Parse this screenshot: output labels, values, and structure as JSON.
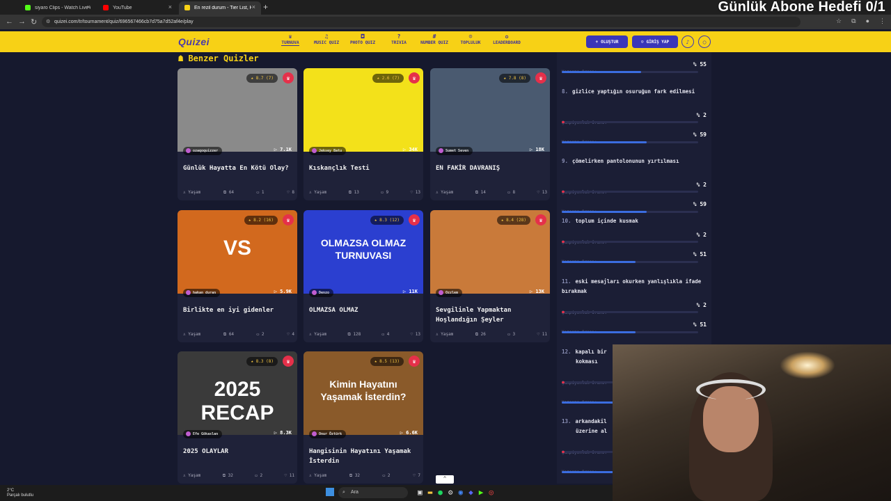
{
  "overlay": {
    "text": "Günlük Abone Hedefi 0/1"
  },
  "browser": {
    "tabs": [
      {
        "title": "siyaro Clips - Watch Live on Kick",
        "color": "#53fc18"
      },
      {
        "title": "YouTube",
        "color": "#ff0000"
      },
      {
        "title": "En rezil durum - Tier List, Kör S...",
        "color": "#f7d116"
      }
    ],
    "url": "quizei.com/tr/tournament/quiz/696567466cb7d75a7d52af4e/play"
  },
  "header": {
    "logo": "Quizei",
    "nav": [
      {
        "label": "TURNUVA",
        "icon": "trophy-icon",
        "glyph": "♛"
      },
      {
        "label": "MUSIC QUIZ",
        "icon": "music-icon",
        "glyph": "♫"
      },
      {
        "label": "PHOTO QUIZ",
        "icon": "camera-icon",
        "glyph": "◘"
      },
      {
        "label": "TRIVIA",
        "icon": "question-icon",
        "glyph": "?"
      },
      {
        "label": "NUMBER QUIZ",
        "icon": "hash-icon",
        "glyph": "#"
      },
      {
        "label": "TOPLULUK",
        "icon": "users-icon",
        "glyph": "☺"
      },
      {
        "label": "LEADERBOARD",
        "icon": "medal-icon",
        "glyph": "✪"
      }
    ],
    "create": "OLUŞTUR",
    "login": "GİRİŞ YAP"
  },
  "section": {
    "title": "Benzer Quizler"
  },
  "cards": [
    {
      "rating": "8.7 (7)",
      "author": "ozaqoquizzer",
      "plays": "7.1K",
      "title": "Günlük Hayatta En Kötü Olay?",
      "category": "Yaşam",
      "items": "64",
      "comments": "1",
      "likes": "8",
      "thumb_text": "",
      "thumb_color": "#8a8a8a"
    },
    {
      "rating": "2.6 (7)",
      "author": "Jeksey Batu",
      "plays": "34K",
      "title": "Kıskançlık Testi",
      "category": "Yaşam",
      "items": "13",
      "comments": "9",
      "likes": "13",
      "thumb_text": "",
      "thumb_color": "#f3e11a"
    },
    {
      "rating": "7.8 (8)",
      "author": "Sumet Seven",
      "plays": "18K",
      "title": "EN FAKİR DAVRANIŞ",
      "category": "Yaşam",
      "items": "14",
      "comments": "8",
      "likes": "13",
      "thumb_text": "",
      "thumb_color": "#4a5a70"
    },
    {
      "rating": "8.2 (16)",
      "author": "hakan duran",
      "plays": "5.9K",
      "title": "Birlikte en iyi gidenler",
      "category": "Yaşam",
      "items": "64",
      "comments": "2",
      "likes": "4",
      "thumb_text": "VS",
      "thumb_color": "#d2691e"
    },
    {
      "rating": "8.3 (12)",
      "author": "Denzo",
      "plays": "11K",
      "title": "OLMAZSA OLMAZ",
      "category": "Yaşam",
      "items": "128",
      "comments": "4",
      "likes": "13",
      "thumb_text": "OLMAZSA OLMAZ TURNUVASI",
      "thumb_color": "#2b3fd0"
    },
    {
      "rating": "8.4 (28)",
      "author": "Ozzlem",
      "plays": "13K",
      "title": "Sevgilinle Yapmaktan Hoşlandığın Şeyler",
      "category": "Yaşam",
      "items": "26",
      "comments": "3",
      "likes": "11",
      "thumb_text": "",
      "thumb_color": "#c97a3a"
    },
    {
      "rating": "8.3 (8)",
      "author": "Efe Gökaslan",
      "plays": "8.3K",
      "title": "2025 OLAYLAR",
      "category": "Yaşam",
      "items": "32",
      "comments": "2",
      "likes": "11",
      "thumb_text": "2025 RECAP",
      "thumb_color": "#3a3a3a"
    },
    {
      "rating": "8.5 (13)",
      "author": "Onur Öztürk",
      "plays": "6.6K",
      "title": "Hangisinin Hayatını Yaşamak İsterdin",
      "category": "Yaşam",
      "items": "32",
      "comments": "2",
      "likes": "7",
      "thumb_text": "Kimin Hayatını Yaşamak İsterdin?",
      "thumb_color": "#8a5a2a"
    }
  ],
  "stats": {
    "champ_label": "Şampiyonluk Oranı:",
    "win_label": "Kazanma Oranı:",
    "top_win_pct": "% 55",
    "top_win_fraction": 0.58,
    "items": [
      {
        "num": "8.",
        "text": "gizlice yaptığın osuruğun fark edilmesi",
        "champ": "% 2",
        "win": "% 59",
        "champ_fraction": 0.02,
        "win_fraction": 0.62
      },
      {
        "num": "9.",
        "text": "çömelirken pantolonunun yırtılması",
        "champ": "% 2",
        "win": "% 59",
        "champ_fraction": 0.02,
        "win_fraction": 0.62
      },
      {
        "num": "10.",
        "text": "toplum içinde kusmak",
        "champ": "% 2",
        "win": "% 51",
        "champ_fraction": 0.02,
        "win_fraction": 0.54
      },
      {
        "num": "11.",
        "text": "eski mesajları okurken yanlışlıkla ifade bırakmak",
        "champ": "% 2",
        "win": "% 51",
        "champ_fraction": 0.02,
        "win_fraction": 0.54
      },
      {
        "num": "12.",
        "text": "kapalı bir",
        "text2": "kokması"
      },
      {
        "num": "13.",
        "text": "arkandakil",
        "text2": "üzerine al"
      }
    ]
  },
  "taskbar": {
    "weather_temp": "2°C",
    "weather_text": "Parçalı bulutlu",
    "search": "Ara"
  }
}
